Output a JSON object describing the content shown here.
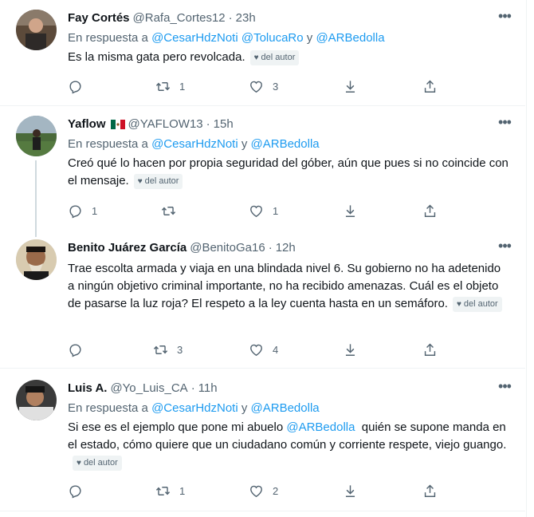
{
  "tweets": [
    {
      "name": "Fay Cortés",
      "handle": "@Rafa_Cortes12",
      "time": "23h",
      "reply_prefix": "En respuesta a",
      "reply_mentions": [
        "@CesarHdzNoti",
        "@TolucaRo",
        "@ARBedolla"
      ],
      "reply_sep": [
        "",
        "y"
      ],
      "text": "Es la misma gata pero revolcada.",
      "badge": "del autor",
      "replies": "",
      "retweets": "1",
      "likes": "3"
    },
    {
      "name": "Yaflow",
      "flag": "mexico-flag-emoji",
      "handle": "@YAFLOW13",
      "time": "15h",
      "reply_prefix": "En respuesta a",
      "reply_mentions": [
        "@CesarHdzNoti",
        "@ARBedolla"
      ],
      "reply_sep": [
        "y"
      ],
      "text": "Creó qué lo hacen por propia seguridad del góber, aún que pues si no coincide con el mensaje.",
      "badge": "del autor",
      "replies": "1",
      "retweets": "",
      "likes": "1"
    },
    {
      "name": "Benito Juárez García",
      "handle": "@BenitoGa16",
      "time": "12h",
      "text": "Trae escolta armada y viaja en una blindada nivel 6. Su gobierno no ha adetenido a ningún objetivo criminal importante, no ha recibido amenazas. Cuál es el objeto de pasarse la luz roja? El respeto a la ley cuenta hasta en un semáforo.",
      "badge": "del autor",
      "replies": "",
      "retweets": "3",
      "likes": "4"
    },
    {
      "name": "Luis A.",
      "handle": "@Yo_Luis_CA",
      "time": "11h",
      "reply_prefix": "En respuesta a",
      "reply_mentions": [
        "@CesarHdzNoti",
        "@ARBedolla"
      ],
      "reply_sep": [
        "y"
      ],
      "text_mention": "@ARBedolla",
      "text_before": "Si ese es el ejemplo que pone mi abuelo ",
      "text_after": "  quién se supone manda en el estado, cómo quiere que un ciudadano común y corriente respete, viejo guango.",
      "badge": "del autor",
      "replies": "",
      "retweets": "1",
      "likes": "2"
    }
  ],
  "colors": {
    "link": "#1d9bf0",
    "muted": "#536471",
    "text": "#0f1419",
    "border": "#eff3f4"
  },
  "icons": [
    "reply-icon",
    "retweet-icon",
    "like-icon",
    "download-icon",
    "share-icon",
    "more-icon"
  ]
}
